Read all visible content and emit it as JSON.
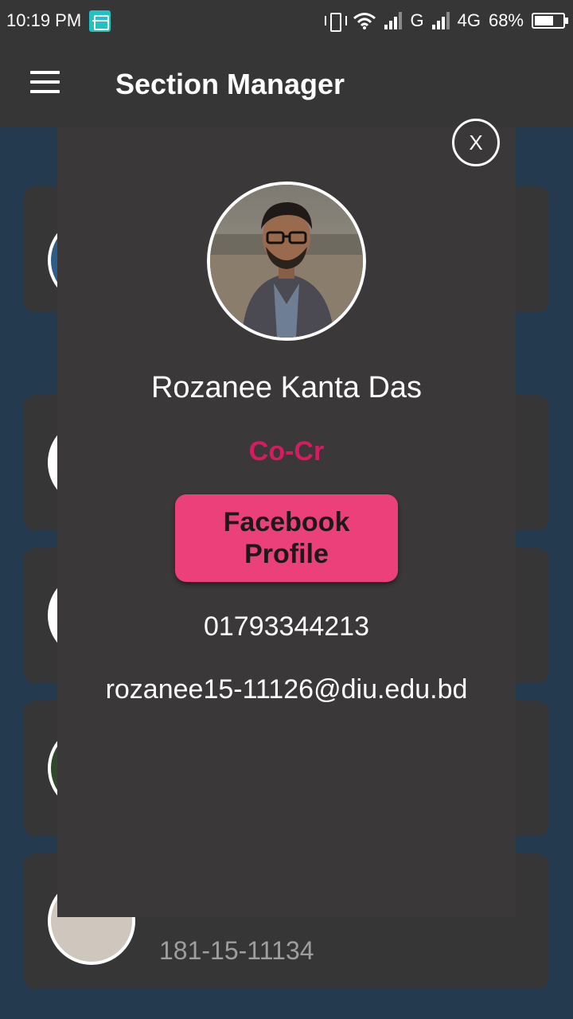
{
  "status_bar": {
    "time": "10:19 PM",
    "network_1": "G",
    "network_2": "4G",
    "battery_percent": "68%",
    "battery_level": 0.68
  },
  "app_bar": {
    "title": "Section Manager"
  },
  "background_list": {
    "items": [
      {
        "id_text": ""
      },
      {
        "id_text": ""
      },
      {
        "id_text": ""
      },
      {
        "id_text": ""
      },
      {
        "id_text": "181-15-11134"
      }
    ]
  },
  "dialog": {
    "close_label": "X",
    "name": "Rozanee Kanta Das",
    "role": "Co-Cr",
    "facebook_button_label": "Facebook Profile",
    "phone": "01793344213",
    "email": "rozanee15-11126@diu.edu.bd"
  },
  "colors": {
    "role_accent": "#d81b60",
    "button_pink": "#ec407a",
    "surface": "#373637",
    "background": "#243a4f"
  }
}
